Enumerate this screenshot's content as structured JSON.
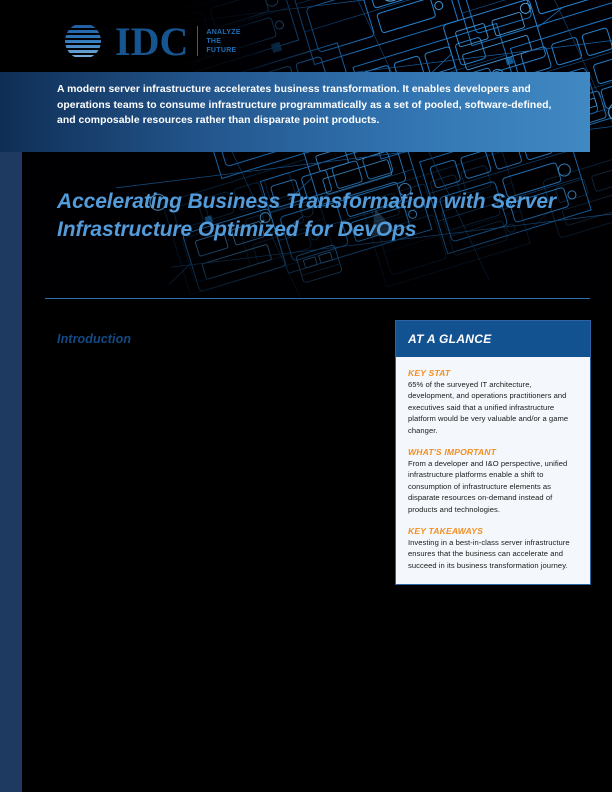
{
  "brand": {
    "logo_wordmark": "IDC",
    "logo_tagline": "ANALYZE\nTHE\nFUTURE",
    "logo_mark_icon": "idc-globe-icon"
  },
  "banner": {
    "text": "A modern server infrastructure accelerates business transformation. It enables developers and operations teams to consume infrastructure programmatically as a set of pooled, software-defined, and composable resources rather than disparate point products."
  },
  "title": {
    "text": "Accelerating Business Transformation with Server Infrastructure Optimized for DevOps"
  },
  "main": {
    "section_heading": "Introduction"
  },
  "glance": {
    "header": "AT A GLANCE",
    "blocks": [
      {
        "label": "KEY STAT",
        "text": "65% of the surveyed IT architecture, development, and operations practitioners and executives said that a unified infrastructure platform would be very valuable and/or a game changer."
      },
      {
        "label": "WHAT'S IMPORTANT",
        "text": "From a developer and I&O perspective, unified infrastructure platforms enable a shift to consumption of infrastructure elements as disparate resources on-demand instead of products and technologies."
      },
      {
        "label": "KEY TAKEAWAYS",
        "text": "Investing in a best-in-class server infrastructure ensures that the business can accelerate and succeed in its business transformation journey."
      }
    ]
  },
  "colors": {
    "page_background": "#000000",
    "side_strip": "#1E3A60",
    "banner_gradient_start": "#0F2E55",
    "banner_gradient_end": "#4189C2",
    "title_blue": "#539BD9",
    "heading_blue": "#134A86",
    "glance_header_blue": "#135291",
    "glance_body_background": "#F4F8FC",
    "accent_orange": "#F28E22",
    "rule_blue": "#2E6FAE",
    "logo_blue": "#16558F"
  }
}
